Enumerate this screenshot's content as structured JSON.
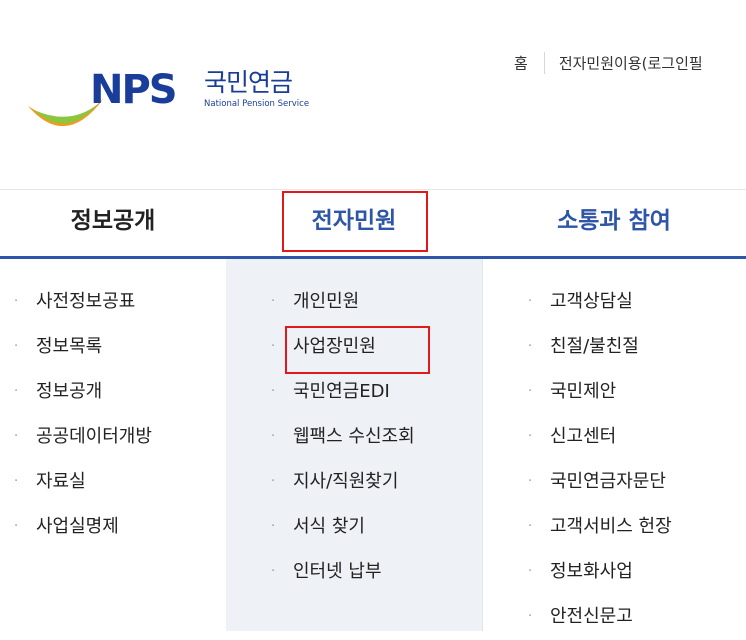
{
  "header": {
    "logo_text": "NPS",
    "brand_ko": "국민연금",
    "brand_en": "National Pension Service",
    "util": [
      "홈",
      "전자민원이용(로그인필"
    ]
  },
  "gnb": [
    {
      "label": "정보공개"
    },
    {
      "label": "전자민원"
    },
    {
      "label": "소통과 참여"
    }
  ],
  "submenus": [
    [
      "사전정보공표",
      "정보목록",
      "정보공개",
      "공공데이터개방",
      "자료실",
      "사업실명제"
    ],
    [
      "개인민원",
      "사업장민원",
      "국민연금EDI",
      "웹팩스 수신조회",
      "지사/직원찾기",
      "서식 찾기",
      "인터넷 납부"
    ],
    [
      "고객상담실",
      "친절/불친절",
      "국민제안",
      "신고센터",
      "국민연금자문단",
      "고객서비스 헌장",
      "정보화사업",
      "안전신문고"
    ]
  ],
  "colors": {
    "brand": "#1a3d99",
    "accent": "#2e55a7",
    "highlight": "#e01a1a",
    "swoosh_orange": "#f39a1e",
    "swoosh_green": "#8cc63f"
  }
}
